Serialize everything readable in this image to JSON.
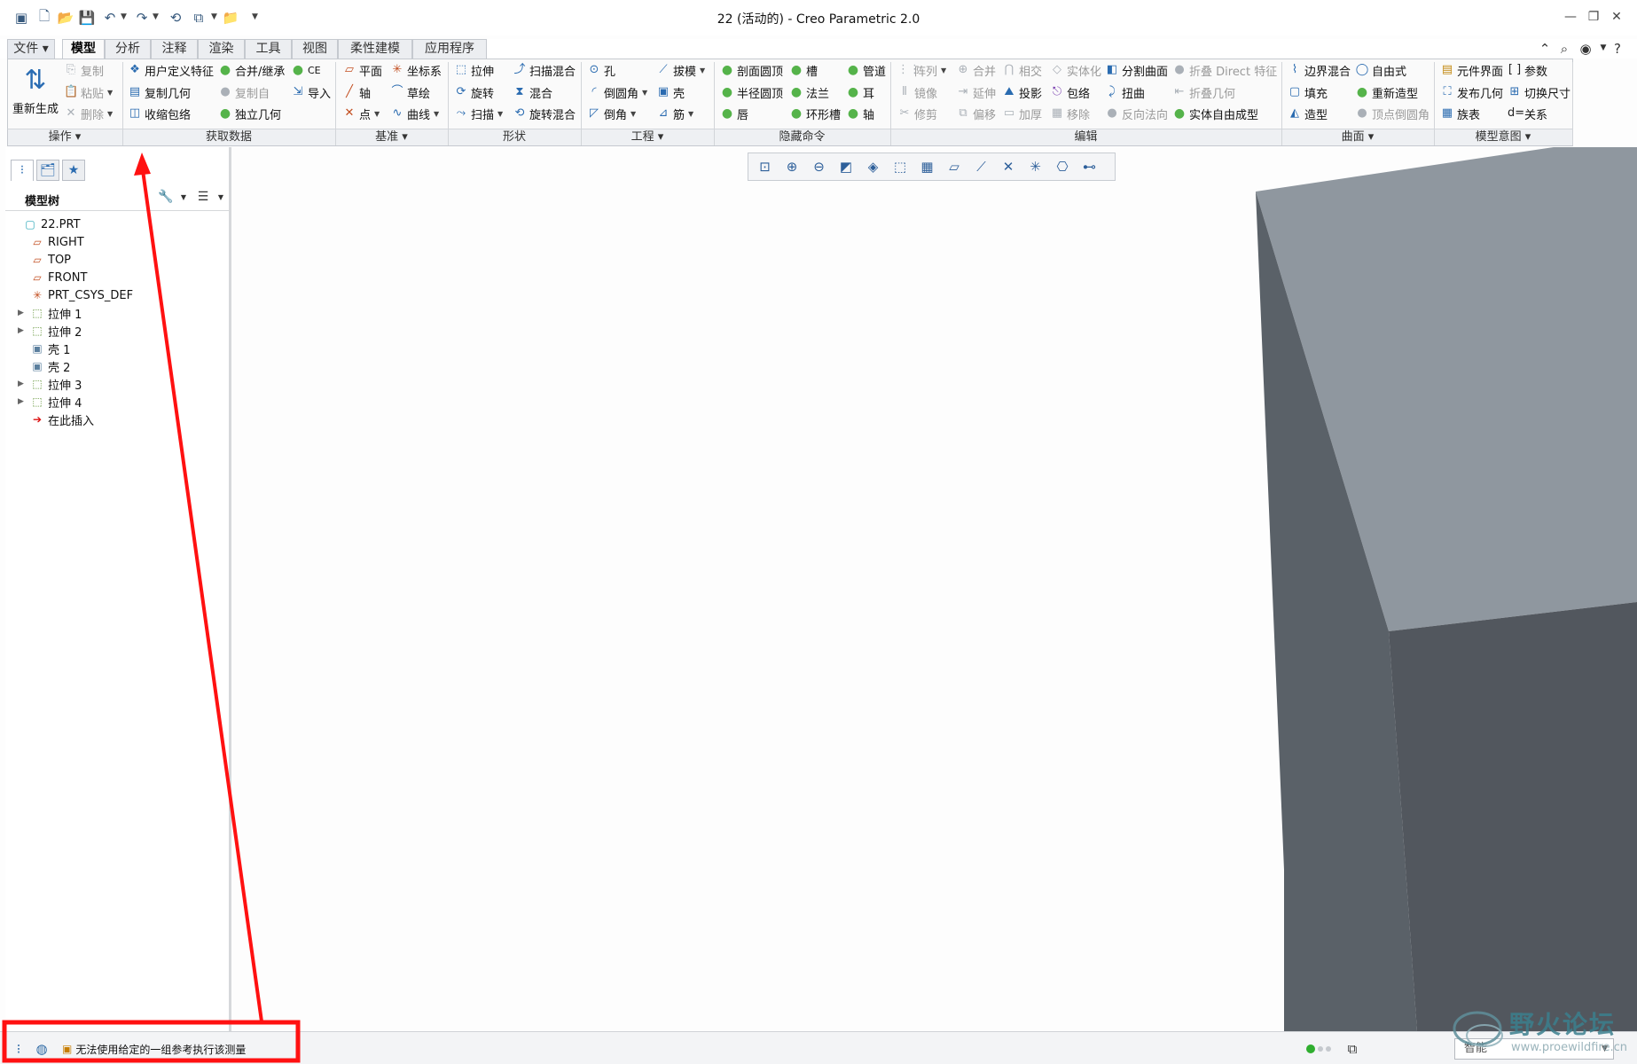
{
  "window": {
    "title": "22 (活动的) - Creo Parametric 2.0"
  },
  "tabs": [
    {
      "label": "文件",
      "state": "file"
    },
    {
      "label": "模型",
      "state": "active"
    },
    {
      "label": "分析",
      "state": ""
    },
    {
      "label": "注释",
      "state": ""
    },
    {
      "label": "渲染",
      "state": ""
    },
    {
      "label": "工具",
      "state": ""
    },
    {
      "label": "视图",
      "state": ""
    },
    {
      "label": "柔性建模",
      "state": ""
    },
    {
      "label": "应用程序",
      "state": ""
    }
  ],
  "ribbon": {
    "regenerate": "重新生成",
    "groups": [
      "操作",
      "获取数据",
      "基准",
      "形状",
      "工程",
      "隐藏命令",
      "编辑",
      "曲面",
      "模型意图"
    ],
    "operations": {
      "copy": "复制",
      "paste": "粘贴",
      "delete": "删除"
    },
    "get_data": {
      "udf": "用户定义特征",
      "copy_geom": "复制几何",
      "shrinkwrap": "收缩包络",
      "merge": "合并/继承",
      "copy_from": "复制自",
      "independent": "独立几何",
      "ce": "CE",
      "import": "导入"
    },
    "datum": {
      "plane": "平面",
      "axis": "轴",
      "point": "点",
      "csys": "坐标系",
      "sketch": "草绘",
      "curve": "曲线"
    },
    "shape": {
      "extrude": "拉伸",
      "revolve": "旋转",
      "sweep": "扫描",
      "swept_blend": "扫描混合",
      "blend": "混合",
      "rot_blend": "旋转混合"
    },
    "engineering": {
      "hole": "孔",
      "round": "倒圆角",
      "chamfer": "倒角",
      "draft": "拔模",
      "shell": "壳",
      "rib": "筋"
    },
    "hidden": {
      "profile_dome": "剖面圆顶",
      "radius_dome": "半径圆顶",
      "lip": "唇",
      "slot": "槽",
      "flange": "法兰",
      "toroidal": "环形槽",
      "pipe": "管道",
      "ear": "耳",
      "shaft": "轴"
    },
    "edit": {
      "pattern": "阵列",
      "mirror": "镜像",
      "trim": "修剪",
      "merge": "合并",
      "extend": "延伸",
      "offset": "偏移",
      "intersect": "相交",
      "project": "投影",
      "thicken": "加厚",
      "solidify": "实体化",
      "wrap": "包络",
      "remove": "移除",
      "split_surface": "分割曲面",
      "twist": "扭曲",
      "reverse_normal": "反向法向",
      "fold_direct": "折叠 Direct 特征",
      "fold_geom": "折叠几何",
      "freeform_solid": "实体自由成型"
    },
    "surface": {
      "boundary_blend": "边界混合",
      "fill": "填充",
      "style": "造型",
      "freestyle": "自由式",
      "restyle": "重新造型",
      "vertex_round": "顶点倒圆角"
    },
    "model_intent": {
      "component_interface": "元件界面",
      "publish_geom": "发布几何",
      "family_table": "族表",
      "parameters": "参数",
      "switch_dims": "切换尺寸",
      "relations": "关系"
    }
  },
  "left_panel": {
    "tree_title": "模型树",
    "nodes": [
      {
        "label": "22.PRT",
        "icon": "part-icon",
        "expandable": false,
        "indent": 0
      },
      {
        "label": "RIGHT",
        "icon": "datum-plane-icon",
        "expandable": false,
        "indent": 1
      },
      {
        "label": "TOP",
        "icon": "datum-plane-icon",
        "expandable": false,
        "indent": 1
      },
      {
        "label": "FRONT",
        "icon": "datum-plane-icon",
        "expandable": false,
        "indent": 1
      },
      {
        "label": "PRT_CSYS_DEF",
        "icon": "csys-icon",
        "expandable": false,
        "indent": 1
      },
      {
        "label": "拉伸 1",
        "icon": "extrude-icon",
        "expandable": true,
        "indent": 1
      },
      {
        "label": "拉伸 2",
        "icon": "extrude-icon",
        "expandable": true,
        "indent": 1
      },
      {
        "label": "壳 1",
        "icon": "shell-icon",
        "expandable": false,
        "indent": 1
      },
      {
        "label": "壳 2",
        "icon": "shell-icon",
        "expandable": false,
        "indent": 1
      },
      {
        "label": "拉伸 3",
        "icon": "extrude-icon",
        "expandable": true,
        "indent": 1
      },
      {
        "label": "拉伸 4",
        "icon": "extrude-icon",
        "expandable": true,
        "indent": 1
      },
      {
        "label": "在此插入",
        "icon": "insert-here-icon",
        "expandable": false,
        "indent": 1
      }
    ]
  },
  "status": {
    "message": "无法使用给定的一组参考执行该测量",
    "filter_value": "智能"
  },
  "watermark": {
    "text": "野火论坛",
    "url": "www.proewildfire.cn"
  },
  "colors": {
    "accent_blue": "#2a6bb0",
    "model_top": "#8e969e",
    "model_left": "#596068",
    "model_right": "#50565d",
    "annotation_red": "#ff1111"
  }
}
